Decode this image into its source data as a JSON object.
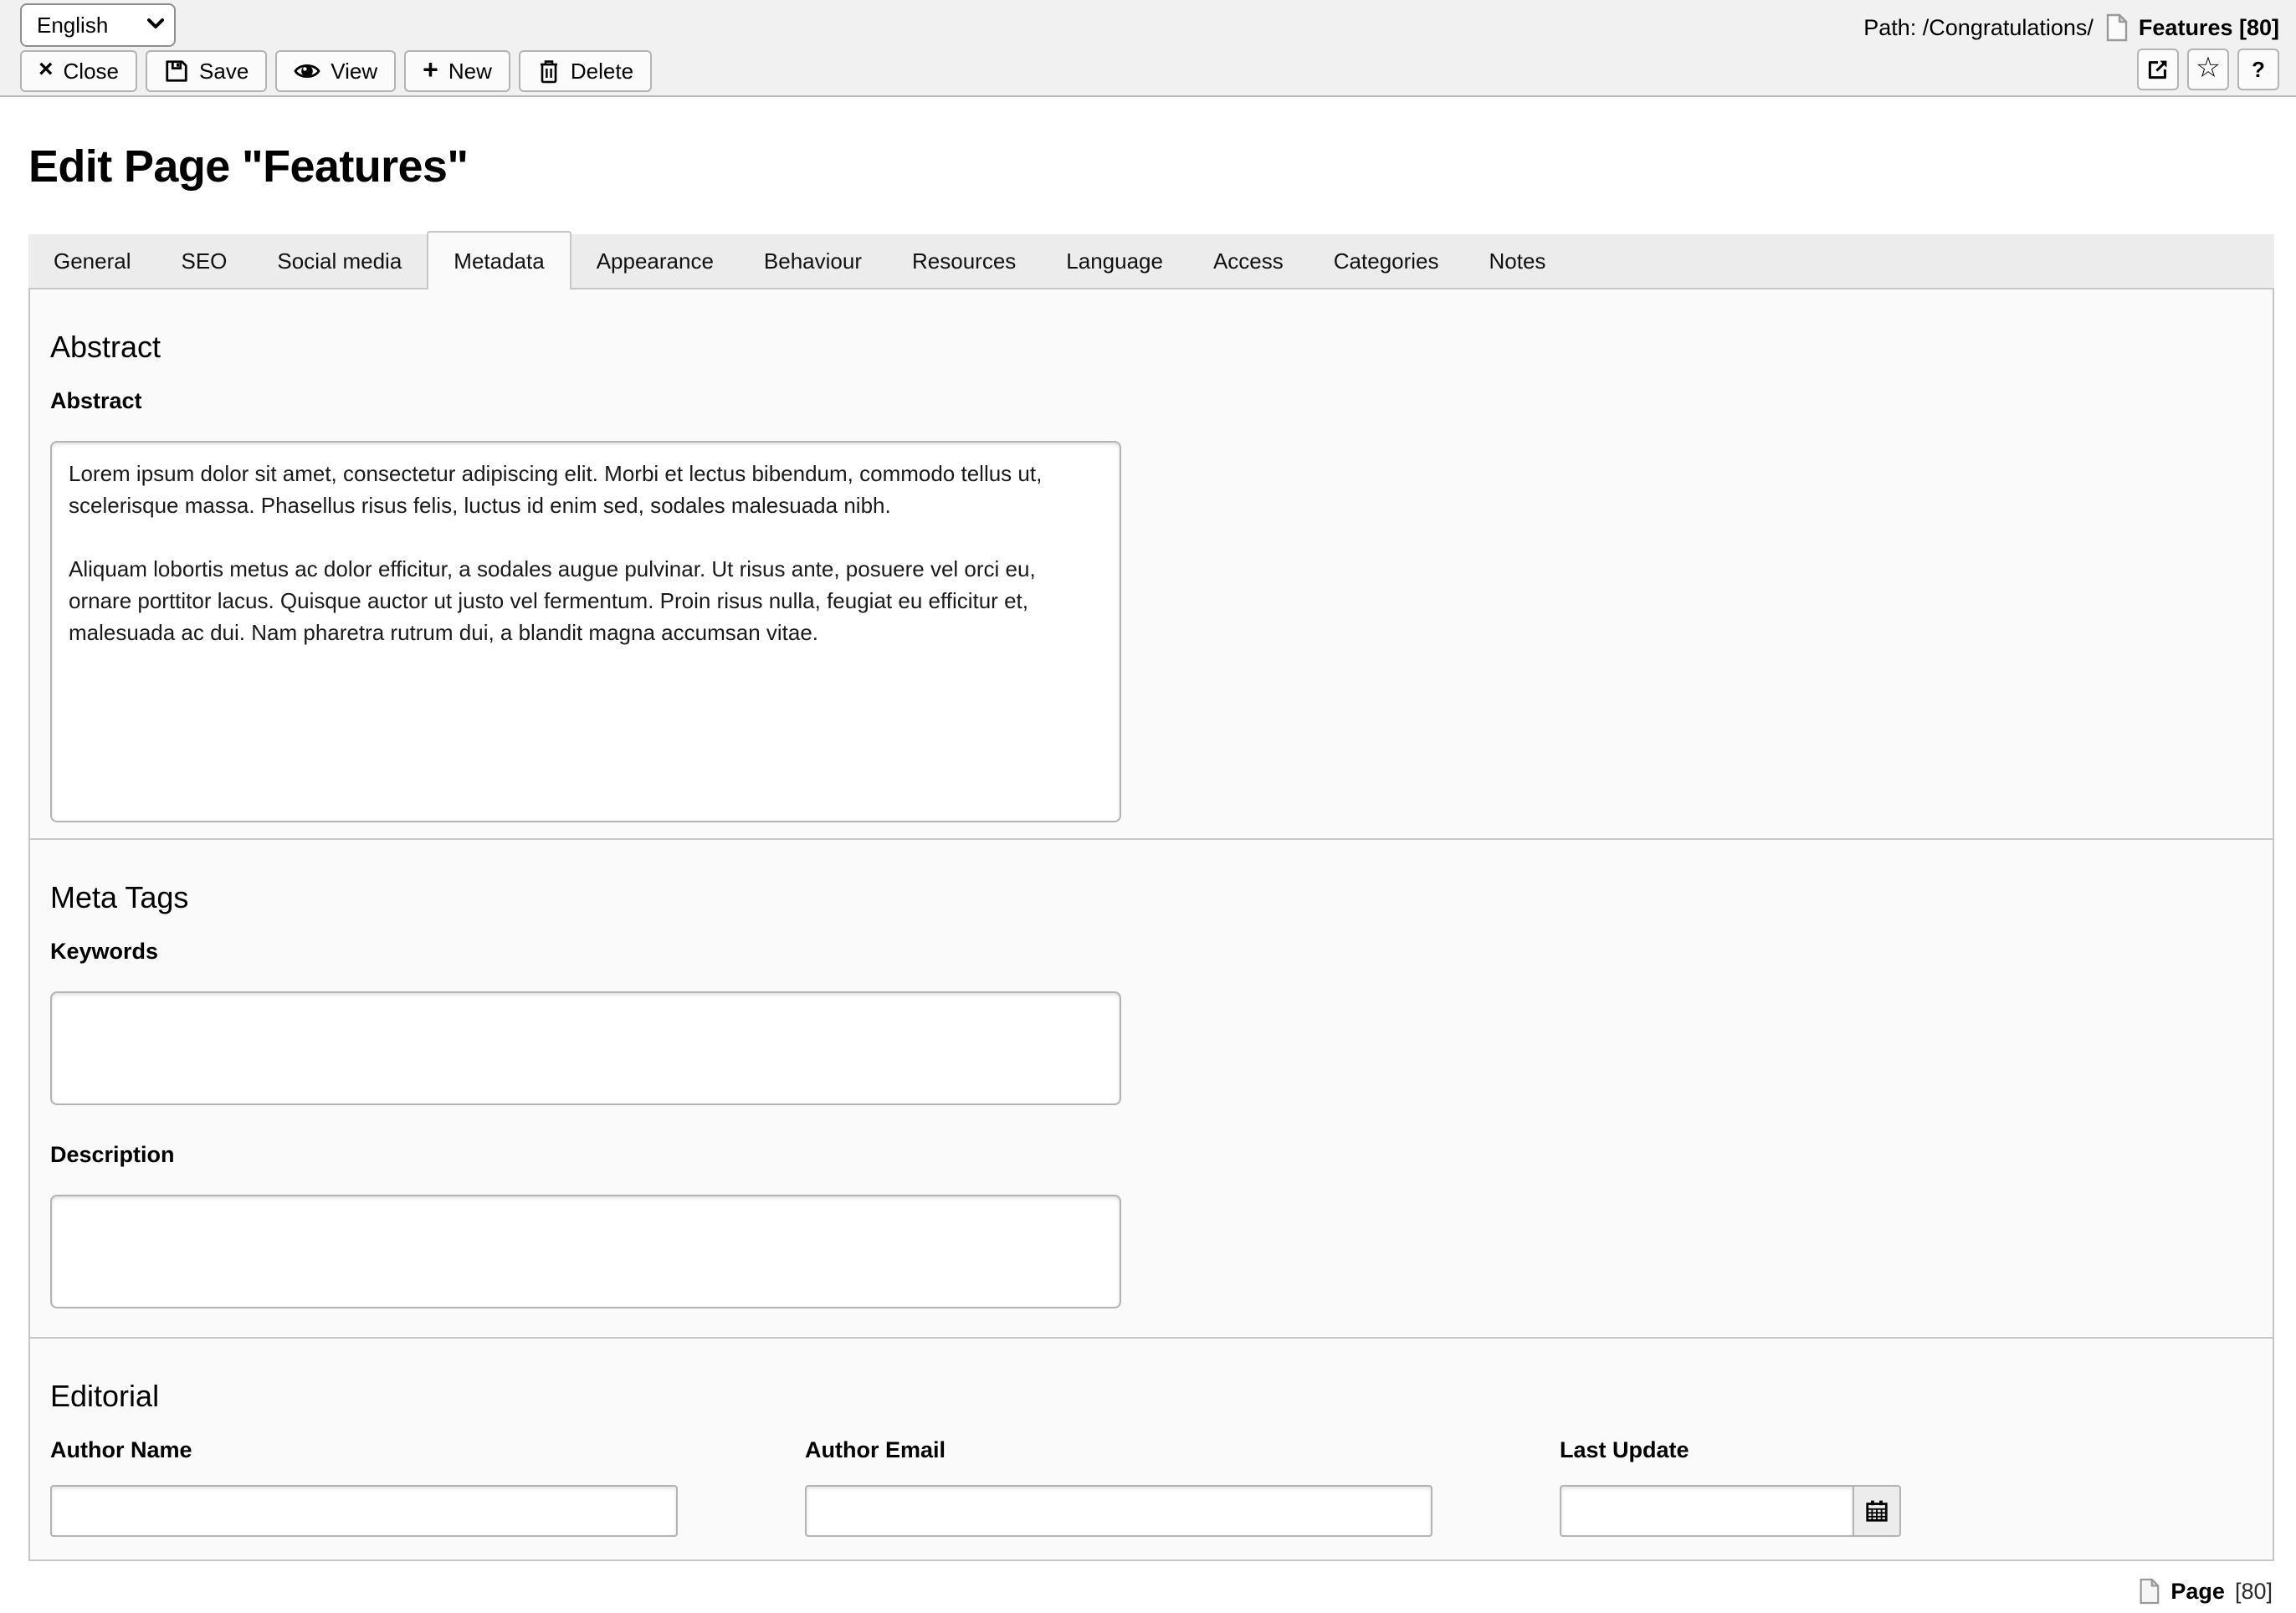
{
  "topbar": {
    "language": {
      "value": "English"
    },
    "path": {
      "label": "Path: /Congratulations/",
      "record": "Features [80]"
    },
    "toolbar": {
      "close": "Close",
      "save": "Save",
      "view": "View",
      "new": "New",
      "delete": "Delete"
    },
    "icons": {
      "close": "×",
      "new": "+",
      "star": "☆",
      "help": "?"
    }
  },
  "page_title": "Edit Page \"Features\"",
  "tabs": {
    "active": "Metadata",
    "items": [
      {
        "label": "General"
      },
      {
        "label": "SEO"
      },
      {
        "label": "Social media"
      },
      {
        "label": "Metadata"
      },
      {
        "label": "Appearance"
      },
      {
        "label": "Behaviour"
      },
      {
        "label": "Resources"
      },
      {
        "label": "Language"
      },
      {
        "label": "Access"
      },
      {
        "label": "Categories"
      },
      {
        "label": "Notes"
      }
    ]
  },
  "sections": {
    "abstract": {
      "title": "Abstract",
      "abstract_label": "Abstract",
      "abstract_value": "Lorem ipsum dolor sit amet, consectetur adipiscing elit. Morbi et lectus bibendum, commodo tellus ut, scelerisque massa. Phasellus risus felis, luctus id enim sed, sodales malesuada nibh.\n\nAliquam lobortis metus ac dolor efficitur, a sodales augue pulvinar. Ut risus ante, posuere vel orci eu, ornare porttitor lacus. Quisque auctor ut justo vel fermentum. Proin risus nulla, feugiat eu efficitur et, malesuada ac dui. Nam pharetra rutrum dui, a blandit magna accumsan vitae."
    },
    "meta_tags": {
      "title": "Meta Tags",
      "keywords_label": "Keywords",
      "keywords_value": "",
      "description_label": "Description",
      "description_value": ""
    },
    "editorial": {
      "title": "Editorial",
      "author_name_label": "Author Name",
      "author_name_value": "",
      "author_email_label": "Author Email",
      "author_email_value": "",
      "last_update_label": "Last Update",
      "last_update_value": ""
    }
  },
  "footer": {
    "record_type": "Page",
    "record_uid": "[80]"
  }
}
